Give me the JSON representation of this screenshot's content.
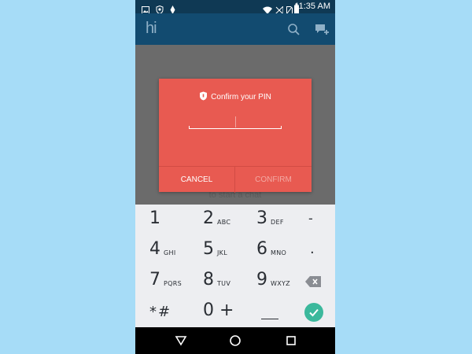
{
  "status_bar": {
    "time": "11:35 AM",
    "icons": [
      "image-icon",
      "shield-icon",
      "diamond-icon",
      "wifi-icon",
      "no-signal-icon",
      "sim-icon",
      "battery-icon"
    ]
  },
  "app_bar": {
    "logo": "hi",
    "icons": [
      "search-icon",
      "compose-chat-icon"
    ]
  },
  "background": {
    "hint_text": "to start a chat"
  },
  "dialog": {
    "title": "Confirm your PIN",
    "title_icon": "shield-icon",
    "pin_value": "",
    "cancel_label": "CANCEL",
    "confirm_label": "CONFIRM",
    "colors": {
      "dialog_bg": "#e85a51",
      "confirm_disabled": "#f3a9a3"
    }
  },
  "keypad": {
    "keys": [
      {
        "digit": "1",
        "letters": ""
      },
      {
        "digit": "2",
        "letters": "ABC"
      },
      {
        "digit": "3",
        "letters": "DEF"
      },
      {
        "digit": "-",
        "letters": ""
      },
      {
        "digit": "4",
        "letters": "GHI"
      },
      {
        "digit": "5",
        "letters": "JKL"
      },
      {
        "digit": "6",
        "letters": "MNO"
      },
      {
        "digit": ".",
        "letters": ""
      },
      {
        "digit": "7",
        "letters": "PQRS"
      },
      {
        "digit": "8",
        "letters": "TUV"
      },
      {
        "digit": "9",
        "letters": "WXYZ"
      },
      {
        "digit": "*#",
        "letters": ""
      },
      {
        "digit": "0 +",
        "letters": ""
      }
    ],
    "icons": [
      "backspace-icon",
      "space-key",
      "checkmark-icon"
    ],
    "colors": {
      "done_button": "#3bb89c"
    }
  },
  "nav_bar": {
    "icons": [
      "back-icon",
      "home-icon",
      "recents-icon"
    ]
  }
}
